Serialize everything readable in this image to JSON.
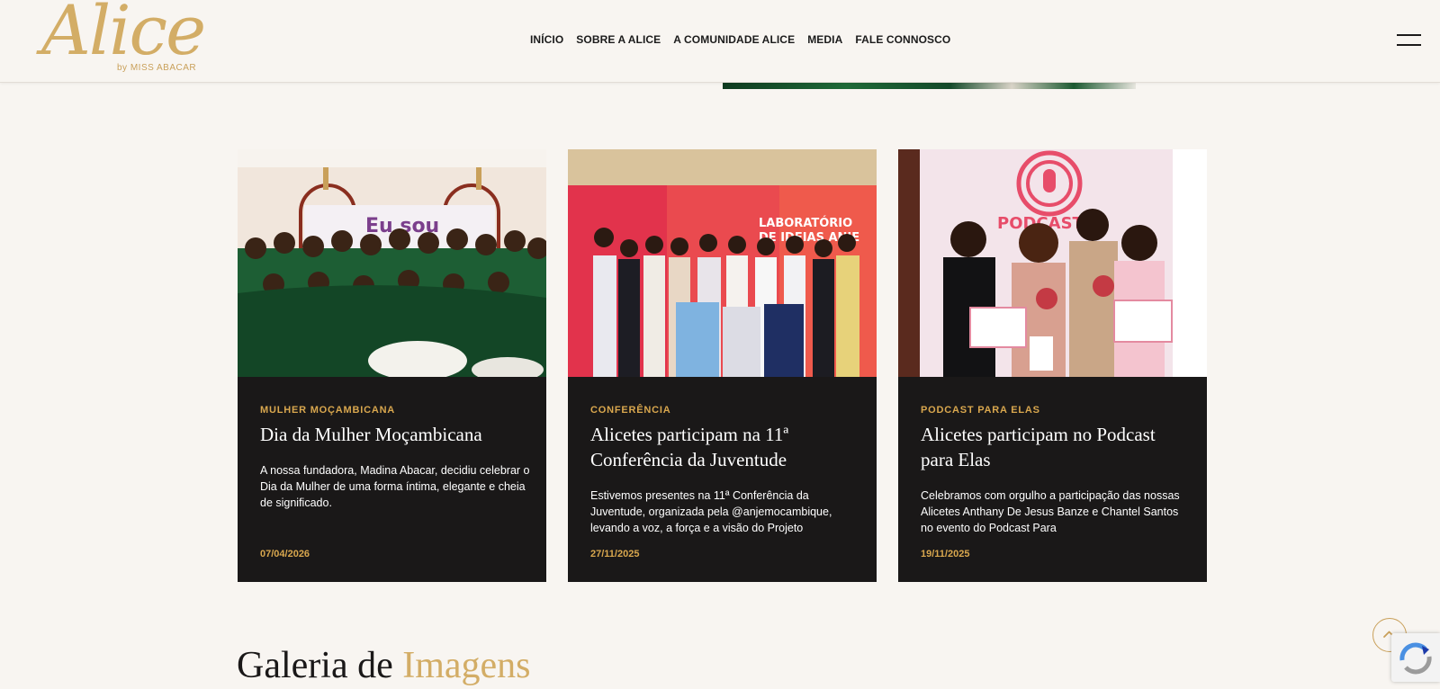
{
  "header": {
    "logo_text": "Alice",
    "logo_sub": "by MISS ABACAR",
    "nav": [
      "INÍCIO",
      "SOBRE A ALICE",
      "A COMUNIDADE ALICE",
      "MEDIA",
      "FALE CONNOSCO"
    ]
  },
  "cards": [
    {
      "category": "MULHER MOÇAMBICANA",
      "title": "Dia da Mulher Moçambicana",
      "text": "A nossa fundadora, Madina Abacar, decidiu celebrar o Dia da Mulher de uma forma íntima, elegante e cheia de significado.",
      "date": "07/04/2026",
      "image_text": "Eu sou"
    },
    {
      "category": "CONFERÊNCIA",
      "title": "Alicetes participam na 11ª Conferência da Juventude",
      "text": "Estivemos presentes na 11ª Conferência da Juventude, organizada pela @anjemocambique, levando a voz, a força e a visão do Projeto",
      "date": "27/11/2025",
      "image_text_1": "LABORATÓRIO",
      "image_text_2": "DE IDEIAS ANJE"
    },
    {
      "category": "PODCAST PARA ELAS",
      "title": "Alicetes participam no Podcast para Elas",
      "text": "Celebramos com orgulho a participação das nossas Alicetes Anthany De Jesus Banze e Chantel Santos no evento do Podcast Para",
      "date": "19/11/2025",
      "image_text": "PODCAST"
    }
  ],
  "gallery": {
    "title_main": "Galeria de",
    "title_accent": "Imagens"
  },
  "colors": {
    "background": "#f8f5f1",
    "card": "#1a1818",
    "accent": "#d3ad66"
  }
}
